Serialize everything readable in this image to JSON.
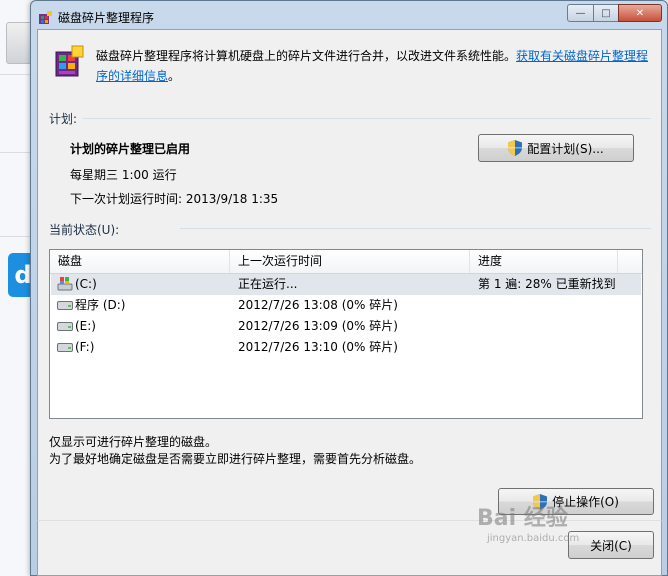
{
  "window": {
    "title": "磁盘碎片整理程序",
    "controls": {
      "minimize": "—",
      "maximize": "□",
      "close": "✕"
    }
  },
  "description": {
    "text": "磁盘碎片整理程序将计算机硬盘上的碎片文件进行合并，以改进文件系统性能。",
    "link": "获取有关磁盘碎片整理程序的详细信息",
    "end": "。"
  },
  "schedule": {
    "section_label": "计划:",
    "status": "计划的碎片整理已启用",
    "frequency": "每星期三  1:00 运行",
    "next_run": "下一次计划运行时间: 2013/9/18 1:35",
    "configure_button": "配置计划(S)..."
  },
  "current_status": {
    "section_label": "当前状态(U):",
    "columns": [
      "磁盘",
      "上一次运行时间",
      "进度"
    ],
    "rows": [
      {
        "disk": "(C:)",
        "last_run": "正在运行...",
        "progress": "第 1 遍: 28% 已重新找到",
        "selected": true
      },
      {
        "disk": "程序 (D:)",
        "last_run": "2012/7/26 13:08 (0% 碎片)",
        "progress": "",
        "selected": false
      },
      {
        "disk": "(E:)",
        "last_run": "2012/7/26 13:09 (0% 碎片)",
        "progress": "",
        "selected": false
      },
      {
        "disk": "(F:)",
        "last_run": "2012/7/26 13:10 (0% 碎片)",
        "progress": "",
        "selected": false
      }
    ]
  },
  "notes": {
    "line1": "仅显示可进行碎片整理的磁盘。",
    "line2": "为了最好地确定磁盘是否需要立即进行碎片整理，需要首先分析磁盘。"
  },
  "actions": {
    "stop_button": "停止操作(O)",
    "close_button": "关闭(C)"
  },
  "watermark": {
    "brand": "Bai 经验",
    "url": "jingyan.baidu.com"
  },
  "colors": {
    "link": "#0066cc",
    "selected_row": "#e1e6ec",
    "close_button": "#c7513a"
  }
}
